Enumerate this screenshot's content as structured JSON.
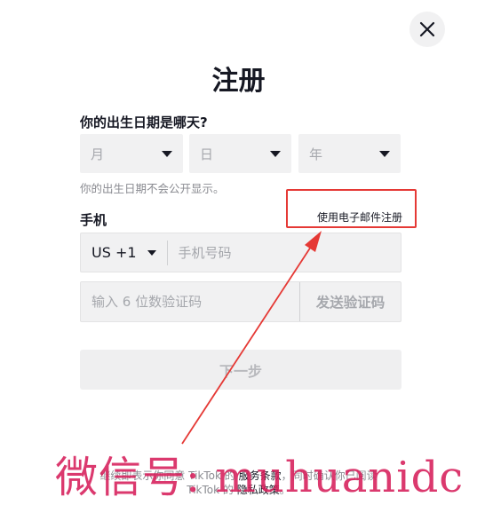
{
  "header": {
    "title": "注册",
    "close_icon": "close-icon"
  },
  "dob": {
    "label": "你的出生日期是哪天?",
    "month_placeholder": "月",
    "day_placeholder": "日",
    "year_placeholder": "年",
    "hint": "你的出生日期不会公开显示。"
  },
  "phone": {
    "label": "手机",
    "email_link": "使用电子邮件注册",
    "country_code": "US +1",
    "placeholder": "手机号码"
  },
  "code": {
    "placeholder": "输入 6 位数验证码",
    "send_label": "发送验证码"
  },
  "next_label": "下一步",
  "terms": {
    "line1_prefix": "继续即表示你同意 TikTok 的",
    "terms_link": "服务条款",
    "line1_suffix": "，同时确认你已阅读",
    "line2_prefix": "TikTok 的",
    "privacy_link": "隐私政策",
    "line2_suffix": "。"
  },
  "watermark": "微信号: muhuanidc",
  "colors": {
    "annotation_red": "#e53935",
    "watermark": "#d61e5a"
  }
}
